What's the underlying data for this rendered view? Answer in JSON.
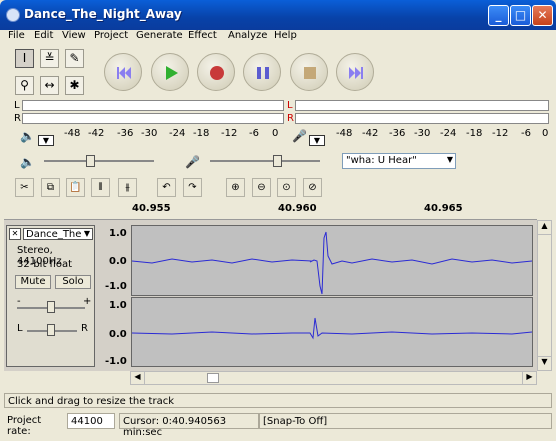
{
  "window": {
    "title": "Dance_The_Night_Away"
  },
  "menu": [
    "File",
    "Edit",
    "View",
    "Project",
    "Generate",
    "Effect",
    "Analyze",
    "Help"
  ],
  "meters": {
    "left_channel": "L",
    "right_channel": "R",
    "scale_labels": [
      "-48",
      "-42",
      "-36",
      "-30",
      "-24",
      "-18",
      "-12",
      "-6",
      "0"
    ]
  },
  "mixer": {
    "input_source": "\"wha: U Hear\""
  },
  "ruler": {
    "labels": [
      "40.955",
      "40.960",
      "40.965"
    ]
  },
  "track": {
    "name": "Dance_The",
    "info_line1": "Stereo, 44100Hz",
    "info_line2": "32-bit float",
    "mute_label": "Mute",
    "solo_label": "Solo",
    "gain_minus": "-",
    "gain_plus": "+",
    "pan_left": "L",
    "pan_right": "R",
    "close_glyph": "✕",
    "dropdown_glyph": "▼",
    "amp_labels": [
      "1.0",
      "0.0",
      "-1.0"
    ]
  },
  "status": {
    "message": "Click and drag to resize the track"
  },
  "bottom": {
    "rate_label": "Project rate:",
    "rate_value": "44100",
    "cursor_text": "Cursor: 0:40.940563 min:sec",
    "snap_text": "[Snap-To Off]"
  },
  "colors": {
    "waveform": "#2a2ad4",
    "title_bar": "#0842a8"
  },
  "icons": [
    "selection-tool-icon",
    "envelope-tool-icon",
    "draw-tool-icon",
    "zoom-tool-icon",
    "timeshift-tool-icon",
    "multi-tool-icon",
    "skip-start-icon",
    "play-icon",
    "record-icon",
    "pause-icon",
    "stop-icon",
    "skip-end-icon",
    "speaker-icon",
    "microphone-icon"
  ]
}
